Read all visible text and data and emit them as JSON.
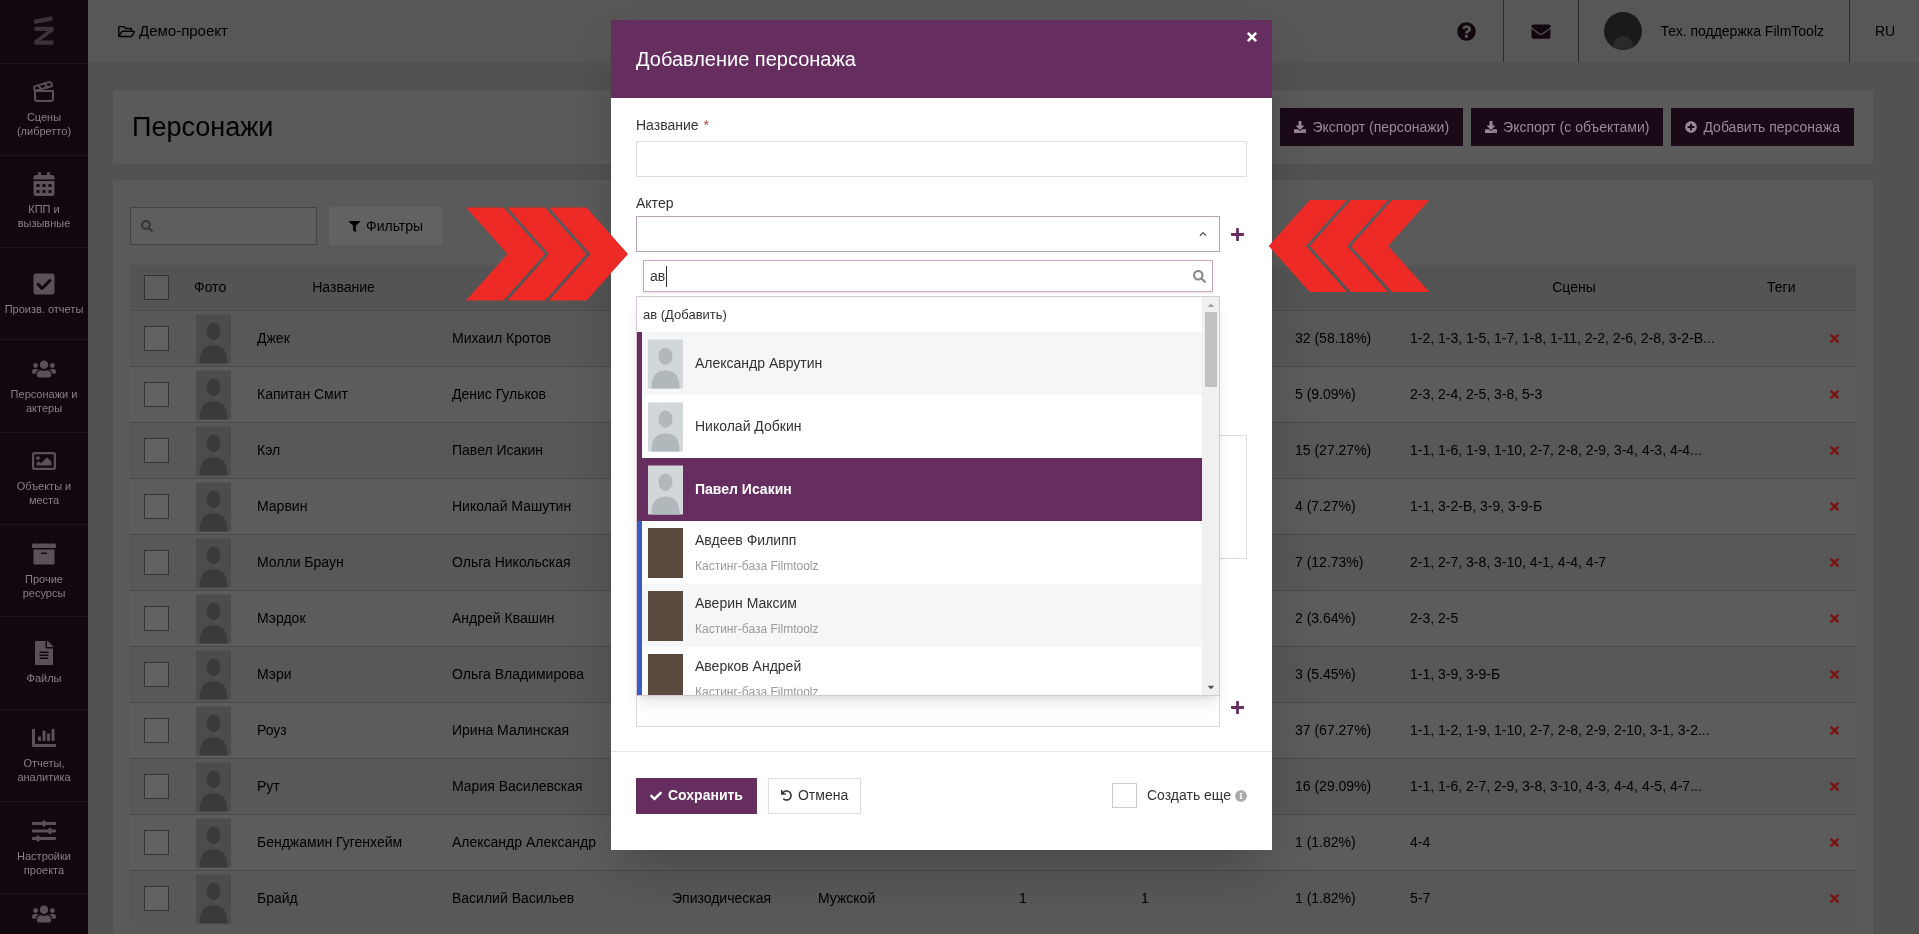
{
  "sidebar": {
    "items": [
      {
        "label": "Сцены (либретто)"
      },
      {
        "label": "КПП и вызывные"
      },
      {
        "label": "Произв. отчеты"
      },
      {
        "label": "Персонажи и актеры"
      },
      {
        "label": "Объекты и места"
      },
      {
        "label": "Прочие ресурсы"
      },
      {
        "label": "Файлы"
      },
      {
        "label": "Отчеты, аналитика"
      },
      {
        "label": "Настройки проекта"
      }
    ]
  },
  "topbar": {
    "project": "Демо-проект",
    "user": "Тех. поддержка FilmToolz",
    "language": "RU"
  },
  "page": {
    "title": "Персонажи",
    "buttons": [
      "Экспорт (персонажи)",
      "Экспорт (с объектами)",
      "Добавить персонажа"
    ],
    "filter_button": "Фильтры"
  },
  "table": {
    "select_all_checked": false,
    "columns": {
      "photo": "Фото",
      "name": "Название",
      "scenes": "Сцены",
      "tags": "Теги"
    },
    "rows": [
      {
        "checked": false,
        "name": "Джек",
        "actor": "Михаил Кротов",
        "scene_count": "32 (58.18%)",
        "scenes": "1-2, 1-3, 1-5, 1-7, 1-8, 1-11, 2-2, 2-6, 2-8, 3-2-В..."
      },
      {
        "checked": false,
        "name": "Капитан Смит",
        "actor": "Денис Гульков",
        "scene_count": "5 (9.09%)",
        "scenes": "2-3, 2-4, 2-5, 3-8, 5-3"
      },
      {
        "checked": false,
        "name": "Кэл",
        "actor": "Павел Исакин",
        "scene_count": "15 (27.27%)",
        "scenes": "1-1, 1-6, 1-9, 1-10, 2-7, 2-8, 2-9, 3-4, 4-3, 4-4..."
      },
      {
        "checked": false,
        "name": "Марвин",
        "actor": "Николай Машутин",
        "scene_count": "4 (7.27%)",
        "scenes": "1-1, 3-2-В, 3-9, 3-9-Б"
      },
      {
        "checked": false,
        "name": "Молли Браун",
        "actor": "Ольга Никольская",
        "scene_count": "7 (12.73%)",
        "scenes": "2-1, 2-7, 3-8, 3-10, 4-1, 4-4, 4-7"
      },
      {
        "checked": false,
        "name": "Мэрдок",
        "actor": "Андрей Квашин",
        "scene_count": "2 (3.64%)",
        "scenes": "2-3, 2-5"
      },
      {
        "checked": false,
        "name": "Мэри",
        "actor": "Ольга Владимирова",
        "scene_count": "3 (5.45%)",
        "scenes": "1-1, 3-9, 3-9-Б"
      },
      {
        "checked": false,
        "name": "Роуз",
        "actor": "Ирина Малинская",
        "scene_count": "37 (67.27%)",
        "scenes": "1-1, 1-2, 1-9, 1-10, 2-7, 2-8, 2-9, 2-10, 3-1, 3-2..."
      },
      {
        "checked": false,
        "name": "Рут",
        "actor": "Мария Василевская",
        "scene_count": "16 (29.09%)",
        "scenes": "1-1, 1-6, 2-7, 2-9, 3-8, 3-10, 4-3, 4-4, 4-5, 4-7..."
      },
      {
        "checked": false,
        "name": "Бенджамин Гугенхейм",
        "actor": "Александр Александр",
        "scene_count": "1 (1.82%)",
        "scenes": "4-4"
      },
      {
        "checked": false,
        "name": "Брайд",
        "actor": "Василий Васильев",
        "type": "Эпизодическая",
        "gender": "Мужской",
        "column_8": "1",
        "column_9": "1",
        "scene_count": "1 (1.82%)",
        "scenes": "5-7"
      }
    ]
  },
  "modal": {
    "title": "Добавление персонажа",
    "name_label": "Название",
    "required_mark": "*",
    "actor_label": "Актер",
    "search_value": "ав",
    "add_option": "ав (Добавить)",
    "options": [
      {
        "name": "Александр Аврутин",
        "photo": false,
        "selected": false,
        "color": "#662d5f"
      },
      {
        "name": "Николай Добкин",
        "photo": false,
        "selected": false,
        "color": "#662d5f"
      },
      {
        "name": "Павел Исакин",
        "photo": false,
        "selected": true,
        "color": "#662d5f"
      },
      {
        "name": "Авдеев Филипп",
        "source": "Кастинг-база Filmtoolz",
        "photo": true,
        "selected": false,
        "color": "#3b5bc4"
      },
      {
        "name": "Аверин Максим",
        "source": "Кастинг-база Filmtoolz",
        "photo": true,
        "selected": false,
        "color": "#3b5bc4"
      },
      {
        "name": "Аверков Андрей",
        "source": "Кастинг-база Filmtoolz",
        "photo": true,
        "selected": false,
        "color": "#3b5bc4"
      }
    ],
    "save_button": "Сохранить",
    "cancel_button": "Отмена",
    "create_more": {
      "label": "Создать еще",
      "checked": false
    }
  }
}
